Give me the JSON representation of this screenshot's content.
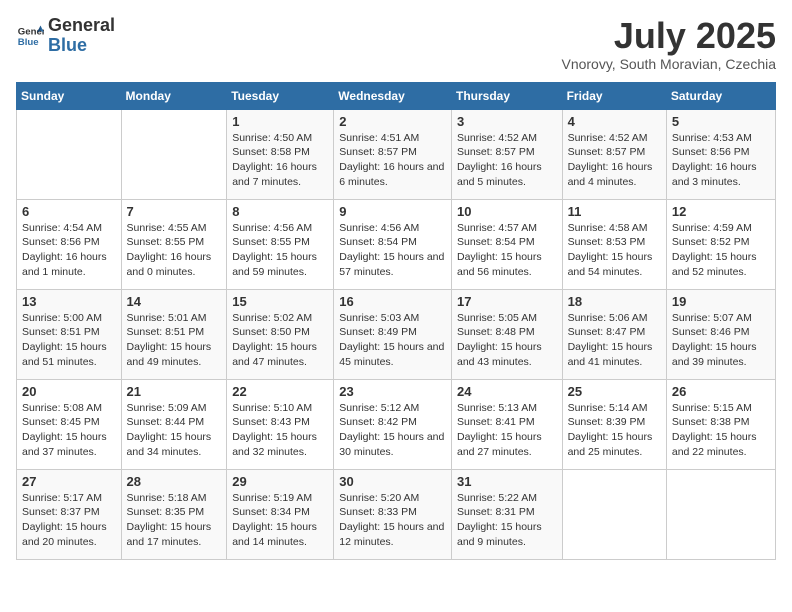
{
  "logo": {
    "general": "General",
    "blue": "Blue"
  },
  "title": "July 2025",
  "subtitle": "Vnorovy, South Moravian, Czechia",
  "days_header": [
    "Sunday",
    "Monday",
    "Tuesday",
    "Wednesday",
    "Thursday",
    "Friday",
    "Saturday"
  ],
  "weeks": [
    [
      {
        "day": "",
        "info": ""
      },
      {
        "day": "",
        "info": ""
      },
      {
        "day": "1",
        "info": "Sunrise: 4:50 AM\nSunset: 8:58 PM\nDaylight: 16 hours and 7 minutes."
      },
      {
        "day": "2",
        "info": "Sunrise: 4:51 AM\nSunset: 8:57 PM\nDaylight: 16 hours and 6 minutes."
      },
      {
        "day": "3",
        "info": "Sunrise: 4:52 AM\nSunset: 8:57 PM\nDaylight: 16 hours and 5 minutes."
      },
      {
        "day": "4",
        "info": "Sunrise: 4:52 AM\nSunset: 8:57 PM\nDaylight: 16 hours and 4 minutes."
      },
      {
        "day": "5",
        "info": "Sunrise: 4:53 AM\nSunset: 8:56 PM\nDaylight: 16 hours and 3 minutes."
      }
    ],
    [
      {
        "day": "6",
        "info": "Sunrise: 4:54 AM\nSunset: 8:56 PM\nDaylight: 16 hours and 1 minute."
      },
      {
        "day": "7",
        "info": "Sunrise: 4:55 AM\nSunset: 8:55 PM\nDaylight: 16 hours and 0 minutes."
      },
      {
        "day": "8",
        "info": "Sunrise: 4:56 AM\nSunset: 8:55 PM\nDaylight: 15 hours and 59 minutes."
      },
      {
        "day": "9",
        "info": "Sunrise: 4:56 AM\nSunset: 8:54 PM\nDaylight: 15 hours and 57 minutes."
      },
      {
        "day": "10",
        "info": "Sunrise: 4:57 AM\nSunset: 8:54 PM\nDaylight: 15 hours and 56 minutes."
      },
      {
        "day": "11",
        "info": "Sunrise: 4:58 AM\nSunset: 8:53 PM\nDaylight: 15 hours and 54 minutes."
      },
      {
        "day": "12",
        "info": "Sunrise: 4:59 AM\nSunset: 8:52 PM\nDaylight: 15 hours and 52 minutes."
      }
    ],
    [
      {
        "day": "13",
        "info": "Sunrise: 5:00 AM\nSunset: 8:51 PM\nDaylight: 15 hours and 51 minutes."
      },
      {
        "day": "14",
        "info": "Sunrise: 5:01 AM\nSunset: 8:51 PM\nDaylight: 15 hours and 49 minutes."
      },
      {
        "day": "15",
        "info": "Sunrise: 5:02 AM\nSunset: 8:50 PM\nDaylight: 15 hours and 47 minutes."
      },
      {
        "day": "16",
        "info": "Sunrise: 5:03 AM\nSunset: 8:49 PM\nDaylight: 15 hours and 45 minutes."
      },
      {
        "day": "17",
        "info": "Sunrise: 5:05 AM\nSunset: 8:48 PM\nDaylight: 15 hours and 43 minutes."
      },
      {
        "day": "18",
        "info": "Sunrise: 5:06 AM\nSunset: 8:47 PM\nDaylight: 15 hours and 41 minutes."
      },
      {
        "day": "19",
        "info": "Sunrise: 5:07 AM\nSunset: 8:46 PM\nDaylight: 15 hours and 39 minutes."
      }
    ],
    [
      {
        "day": "20",
        "info": "Sunrise: 5:08 AM\nSunset: 8:45 PM\nDaylight: 15 hours and 37 minutes."
      },
      {
        "day": "21",
        "info": "Sunrise: 5:09 AM\nSunset: 8:44 PM\nDaylight: 15 hours and 34 minutes."
      },
      {
        "day": "22",
        "info": "Sunrise: 5:10 AM\nSunset: 8:43 PM\nDaylight: 15 hours and 32 minutes."
      },
      {
        "day": "23",
        "info": "Sunrise: 5:12 AM\nSunset: 8:42 PM\nDaylight: 15 hours and 30 minutes."
      },
      {
        "day": "24",
        "info": "Sunrise: 5:13 AM\nSunset: 8:41 PM\nDaylight: 15 hours and 27 minutes."
      },
      {
        "day": "25",
        "info": "Sunrise: 5:14 AM\nSunset: 8:39 PM\nDaylight: 15 hours and 25 minutes."
      },
      {
        "day": "26",
        "info": "Sunrise: 5:15 AM\nSunset: 8:38 PM\nDaylight: 15 hours and 22 minutes."
      }
    ],
    [
      {
        "day": "27",
        "info": "Sunrise: 5:17 AM\nSunset: 8:37 PM\nDaylight: 15 hours and 20 minutes."
      },
      {
        "day": "28",
        "info": "Sunrise: 5:18 AM\nSunset: 8:35 PM\nDaylight: 15 hours and 17 minutes."
      },
      {
        "day": "29",
        "info": "Sunrise: 5:19 AM\nSunset: 8:34 PM\nDaylight: 15 hours and 14 minutes."
      },
      {
        "day": "30",
        "info": "Sunrise: 5:20 AM\nSunset: 8:33 PM\nDaylight: 15 hours and 12 minutes."
      },
      {
        "day": "31",
        "info": "Sunrise: 5:22 AM\nSunset: 8:31 PM\nDaylight: 15 hours and 9 minutes."
      },
      {
        "day": "",
        "info": ""
      },
      {
        "day": "",
        "info": ""
      }
    ]
  ]
}
